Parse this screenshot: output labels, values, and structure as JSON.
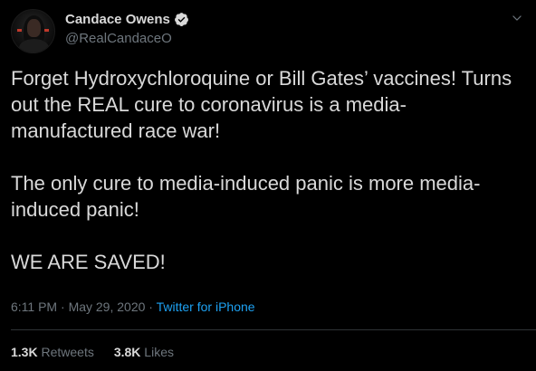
{
  "author": {
    "display_name": "Candace Owens",
    "handle": "@RealCandaceO",
    "verified": true
  },
  "tweet": {
    "paragraphs": [
      "Forget Hydroxychloroquine or Bill Gates’ vaccines! Turns out the REAL cure to coronavirus is a media-manufactured race war!",
      "The only cure to media-induced panic is more media-induced panic!",
      "WE ARE SAVED!"
    ],
    "time": "6:11 PM",
    "date": "May 29, 2020",
    "source": "Twitter for iPhone"
  },
  "stats": {
    "retweets_count": "1.3K",
    "retweets_label": "Retweets",
    "likes_count": "3.8K",
    "likes_label": "Likes"
  },
  "icons": {
    "verified": "verified-badge-icon",
    "menu": "chevron-down-icon"
  },
  "colors": {
    "background": "#000000",
    "text": "#d9d9d9",
    "muted": "#6e767d",
    "link": "#1da1f2",
    "verified": "#d9d9d9"
  }
}
